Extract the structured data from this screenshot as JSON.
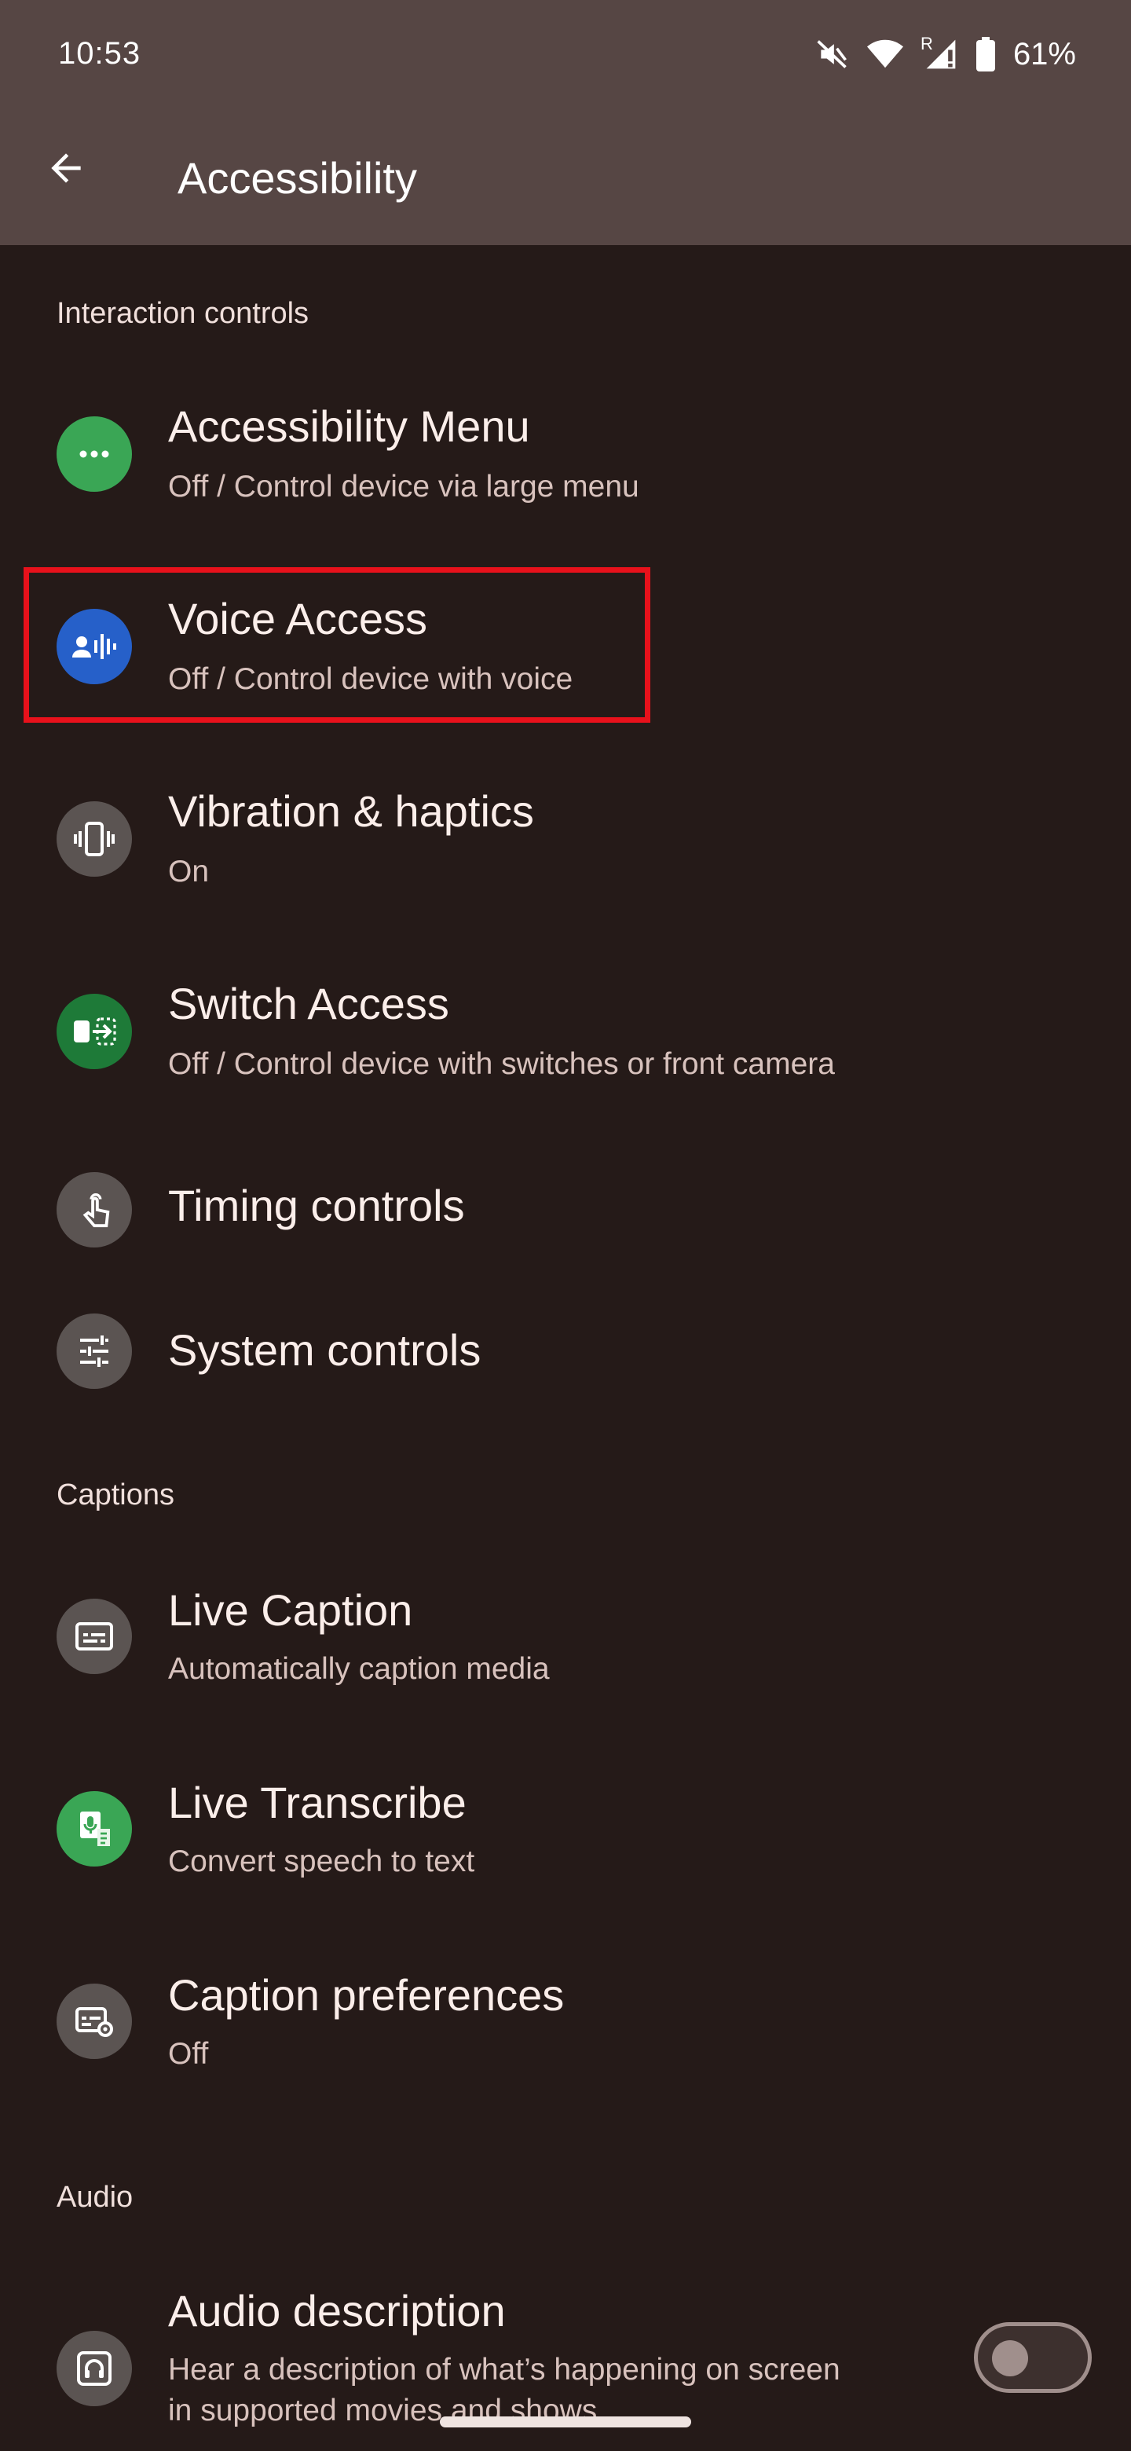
{
  "status_bar": {
    "time": "10:53",
    "carrier_r": "R",
    "battery": "61%"
  },
  "header": {
    "title": "Accessibility"
  },
  "sections": {
    "interaction_controls": "Interaction controls",
    "captions": "Captions",
    "audio": "Audio"
  },
  "items": {
    "accessibility_menu": {
      "title": "Accessibility Menu",
      "subtitle": "Off / Control device via large menu"
    },
    "voice_access": {
      "title": "Voice Access",
      "subtitle": "Off / Control device with voice"
    },
    "vibration": {
      "title": "Vibration & haptics",
      "subtitle": "On"
    },
    "switch_access": {
      "title": "Switch Access",
      "subtitle": "Off / Control device with switches or front camera"
    },
    "timing": {
      "title": "Timing controls"
    },
    "system": {
      "title": "System controls"
    },
    "live_caption": {
      "title": "Live Caption",
      "subtitle": "Automatically caption media"
    },
    "live_transcribe": {
      "title": "Live Transcribe",
      "subtitle": "Convert speech to text"
    },
    "caption_prefs": {
      "title": "Caption preferences",
      "subtitle": "Off"
    },
    "audio_description": {
      "title": "Audio description",
      "subtitle_line1": "Hear a description of what’s happening on screen",
      "subtitle_line2": "in supported movies and shows",
      "toggle_on": false
    }
  },
  "colors": {
    "background": "#251a18",
    "app_bar": "#564644",
    "green": "#3aa655",
    "blue": "#2660c9",
    "dark_green": "#1e7a38",
    "gray_icon": "#5b5452",
    "highlight": "#e8111b"
  },
  "icons": {
    "back": "arrow-left-icon",
    "mute": "vibrate-mute-icon",
    "wifi": "wifi-icon",
    "signal": "cell-signal-icon",
    "battery": "battery-icon"
  }
}
